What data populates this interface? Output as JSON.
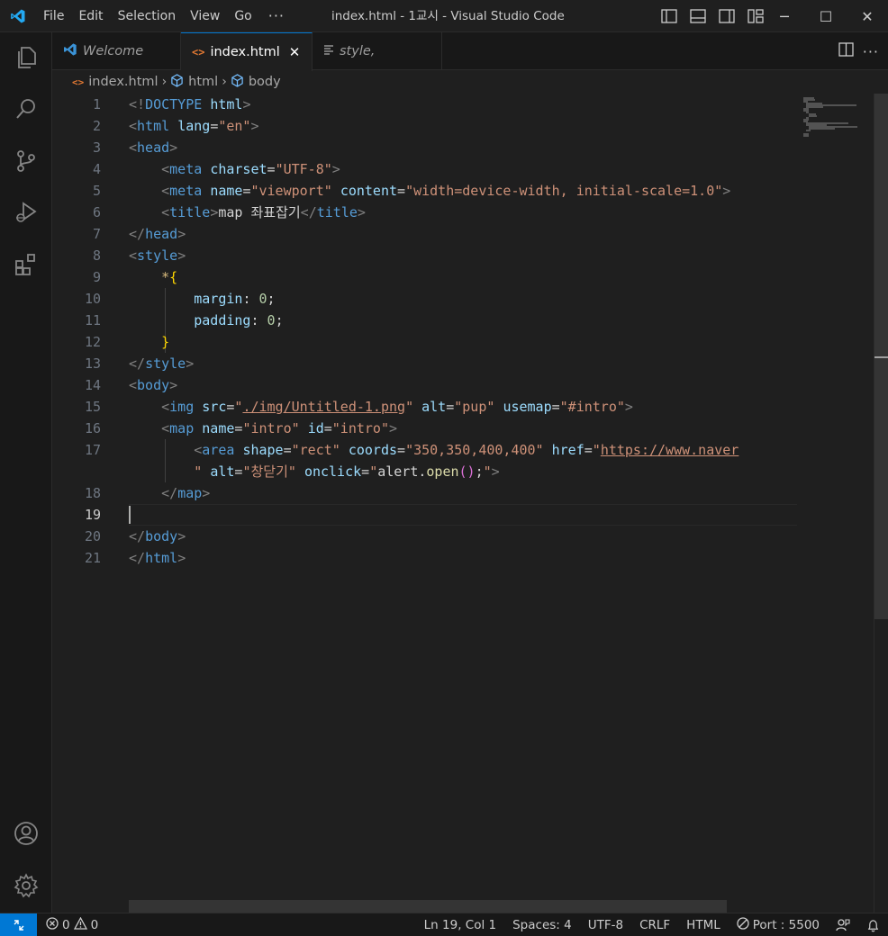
{
  "titlebar": {
    "menu": [
      "File",
      "Edit",
      "Selection",
      "View",
      "Go"
    ],
    "more": "···",
    "title": "index.html - 1교시 - Visual Studio Code",
    "controls": {
      "minimize": "─",
      "maximize": "☐",
      "close": "✕"
    }
  },
  "tabs": [
    {
      "label": "Welcome",
      "icon": "vscode-logo-icon"
    },
    {
      "label": "index.html",
      "icon": "html-file-icon",
      "close": "✕"
    },
    {
      "label": "style,",
      "icon": "text-file-icon"
    }
  ],
  "breadcrumb": {
    "file": "index.html",
    "items": [
      "html",
      "body"
    ]
  },
  "editor": {
    "line_numbers": [
      "1",
      "2",
      "3",
      "4",
      "5",
      "6",
      "7",
      "8",
      "9",
      "10",
      "11",
      "12",
      "13",
      "14",
      "15",
      "16",
      "17",
      "",
      "18",
      "19",
      "20",
      "21"
    ],
    "active_line": "19",
    "lines": [
      [
        [
          "br",
          "<!"
        ],
        [
          "tag",
          "DOCTYPE"
        ],
        [
          "txt",
          " "
        ],
        [
          "attr",
          "html"
        ],
        [
          "br",
          ">"
        ]
      ],
      [
        [
          "br",
          "<"
        ],
        [
          "tag",
          "html"
        ],
        [
          "txt",
          " "
        ],
        [
          "attr",
          "lang"
        ],
        [
          "txt",
          "="
        ],
        [
          "str",
          "\"en\""
        ],
        [
          "br",
          ">"
        ]
      ],
      [
        [
          "br",
          "<"
        ],
        [
          "tag",
          "head"
        ],
        [
          "br",
          ">"
        ]
      ],
      [
        [
          "txt",
          "    "
        ],
        [
          "br",
          "<"
        ],
        [
          "tag",
          "meta"
        ],
        [
          "txt",
          " "
        ],
        [
          "attr",
          "charset"
        ],
        [
          "txt",
          "="
        ],
        [
          "str",
          "\"UTF-8\""
        ],
        [
          "br",
          ">"
        ]
      ],
      [
        [
          "txt",
          "    "
        ],
        [
          "br",
          "<"
        ],
        [
          "tag",
          "meta"
        ],
        [
          "txt",
          " "
        ],
        [
          "attr",
          "name"
        ],
        [
          "txt",
          "="
        ],
        [
          "str",
          "\"viewport\""
        ],
        [
          "txt",
          " "
        ],
        [
          "attr",
          "content"
        ],
        [
          "txt",
          "="
        ],
        [
          "str",
          "\"width=device-width, initial-scale=1.0\""
        ],
        [
          "br",
          ">"
        ]
      ],
      [
        [
          "txt",
          "    "
        ],
        [
          "br",
          "<"
        ],
        [
          "tag",
          "title"
        ],
        [
          "br",
          ">"
        ],
        [
          "txt",
          "map 좌표잡기"
        ],
        [
          "br",
          "</"
        ],
        [
          "tag",
          "title"
        ],
        [
          "br",
          ">"
        ]
      ],
      [
        [
          "br",
          "</"
        ],
        [
          "tag",
          "head"
        ],
        [
          "br",
          ">"
        ]
      ],
      [
        [
          "br",
          "<"
        ],
        [
          "tag",
          "style"
        ],
        [
          "br",
          ">"
        ]
      ],
      [
        [
          "txt",
          "    "
        ],
        [
          "sel",
          "*"
        ],
        [
          "brace",
          "{"
        ]
      ],
      [
        [
          "txt",
          "        "
        ],
        [
          "prop",
          "margin"
        ],
        [
          "txt",
          ": "
        ],
        [
          "num",
          "0"
        ],
        [
          "txt",
          ";"
        ]
      ],
      [
        [
          "txt",
          "        "
        ],
        [
          "prop",
          "padding"
        ],
        [
          "txt",
          ": "
        ],
        [
          "num",
          "0"
        ],
        [
          "txt",
          ";"
        ]
      ],
      [
        [
          "txt",
          "    "
        ],
        [
          "brace",
          "}"
        ]
      ],
      [
        [
          "br",
          "</"
        ],
        [
          "tag",
          "style"
        ],
        [
          "br",
          ">"
        ]
      ],
      [
        [
          "br",
          "<"
        ],
        [
          "tag",
          "body"
        ],
        [
          "br",
          ">"
        ]
      ],
      [
        [
          "txt",
          "    "
        ],
        [
          "br",
          "<"
        ],
        [
          "tag",
          "img"
        ],
        [
          "txt",
          " "
        ],
        [
          "attr",
          "src"
        ],
        [
          "txt",
          "="
        ],
        [
          "str",
          "\""
        ],
        [
          "link",
          "./img/Untitled-1.png"
        ],
        [
          "str",
          "\""
        ],
        [
          "txt",
          " "
        ],
        [
          "attr",
          "alt"
        ],
        [
          "txt",
          "="
        ],
        [
          "str",
          "\"pup\""
        ],
        [
          "txt",
          " "
        ],
        [
          "attr",
          "usemap"
        ],
        [
          "txt",
          "="
        ],
        [
          "str",
          "\"#intro\""
        ],
        [
          "br",
          ">"
        ]
      ],
      [
        [
          "txt",
          "    "
        ],
        [
          "br",
          "<"
        ],
        [
          "tag",
          "map"
        ],
        [
          "txt",
          " "
        ],
        [
          "attr",
          "name"
        ],
        [
          "txt",
          "="
        ],
        [
          "str",
          "\"intro\""
        ],
        [
          "txt",
          " "
        ],
        [
          "attr",
          "id"
        ],
        [
          "txt",
          "="
        ],
        [
          "str",
          "\"intro\""
        ],
        [
          "br",
          ">"
        ]
      ],
      [
        [
          "txt",
          "        "
        ],
        [
          "br",
          "<"
        ],
        [
          "tag",
          "area"
        ],
        [
          "txt",
          " "
        ],
        [
          "attr",
          "shape"
        ],
        [
          "txt",
          "="
        ],
        [
          "str",
          "\"rect\""
        ],
        [
          "txt",
          " "
        ],
        [
          "attr",
          "coords"
        ],
        [
          "txt",
          "="
        ],
        [
          "str",
          "\"350,350,400,400\""
        ],
        [
          "txt",
          " "
        ],
        [
          "attr",
          "href"
        ],
        [
          "txt",
          "="
        ],
        [
          "str",
          "\""
        ],
        [
          "link",
          "https://www.naver"
        ]
      ],
      [
        [
          "txt",
          "        "
        ],
        [
          "str",
          "\""
        ],
        [
          "txt",
          " "
        ],
        [
          "attr",
          "alt"
        ],
        [
          "txt",
          "="
        ],
        [
          "str",
          "\"창닫기\""
        ],
        [
          "txt",
          " "
        ],
        [
          "attr",
          "onclick"
        ],
        [
          "txt",
          "="
        ],
        [
          "str",
          "\""
        ],
        [
          "txt",
          "alert."
        ],
        [
          "fn",
          "open"
        ],
        [
          "paren",
          "()"
        ],
        [
          "txt",
          ";"
        ],
        [
          "str",
          "\""
        ],
        [
          "br",
          ">"
        ]
      ],
      [
        [
          "txt",
          "    "
        ],
        [
          "br",
          "</"
        ],
        [
          "tag",
          "map"
        ],
        [
          "br",
          ">"
        ]
      ],
      [],
      [
        [
          "br",
          "</"
        ],
        [
          "tag",
          "body"
        ],
        [
          "br",
          ">"
        ]
      ],
      [
        [
          "br",
          "</"
        ],
        [
          "tag",
          "html"
        ],
        [
          "br",
          ">"
        ]
      ]
    ]
  },
  "statusbar": {
    "errors": "0",
    "warnings": "0",
    "position": "Ln 19, Col 1",
    "spaces": "Spaces: 4",
    "encoding": "UTF-8",
    "eol": "CRLF",
    "language": "HTML",
    "port": "Port : 5500"
  },
  "colors": {
    "accent": "#0078d4",
    "tag": "#569cd6",
    "attribute": "#9cdcfe",
    "string": "#ce9178",
    "number": "#b5cea8",
    "bracket": "#ffd700"
  }
}
